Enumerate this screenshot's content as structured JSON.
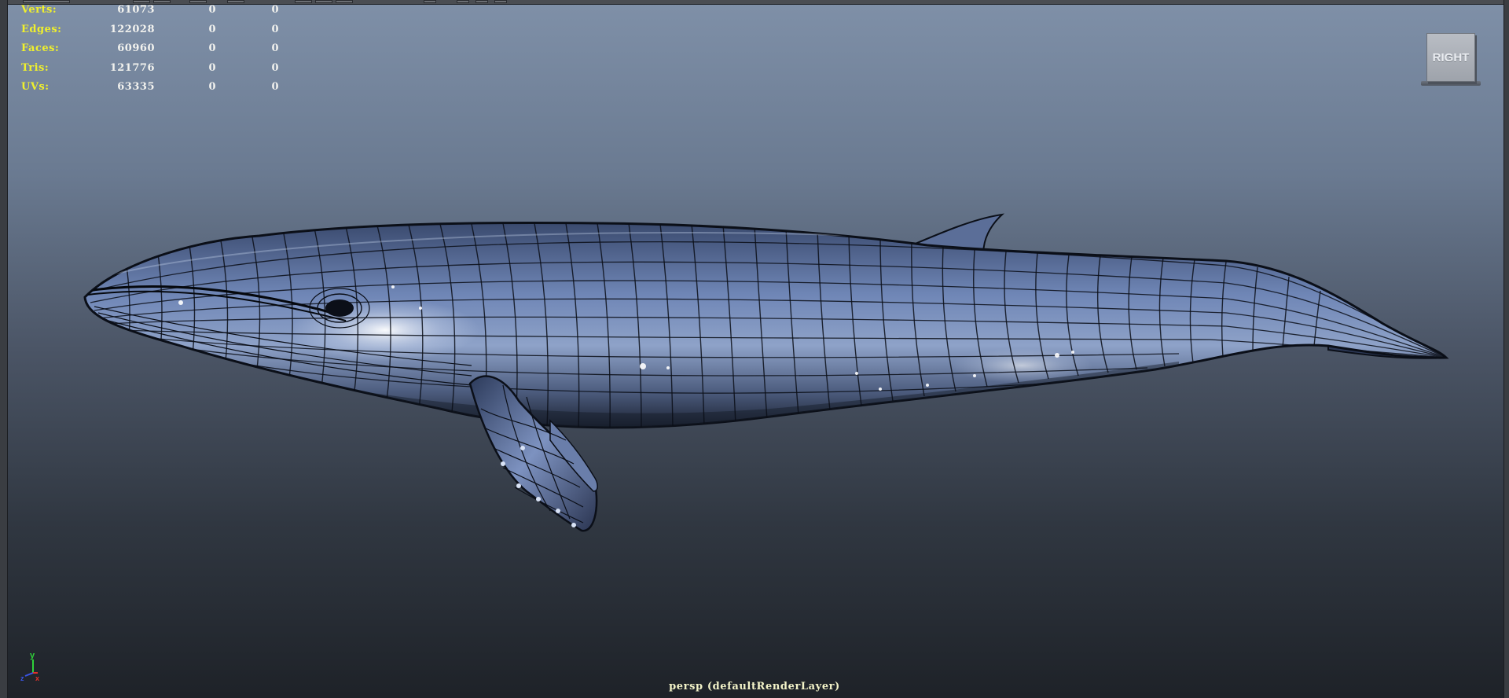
{
  "viewport": {
    "camera_label": "persp (defaultRenderLayer)",
    "view_cube_label": "RIGHT",
    "axis": {
      "y_label": "y",
      "z_label": "z",
      "x_label": "x"
    }
  },
  "hud": {
    "rows": [
      {
        "label": "Verts:",
        "v1": "61073",
        "v2": "0",
        "v3": "0"
      },
      {
        "label": "Edges:",
        "v1": "122028",
        "v2": "0",
        "v3": "0"
      },
      {
        "label": "Faces:",
        "v1": "60960",
        "v2": "0",
        "v3": "0"
      },
      {
        "label": "Tris:",
        "v1": "121776",
        "v2": "0",
        "v3": "0"
      },
      {
        "label": "UVs:",
        "v1": "63335",
        "v2": "0",
        "v3": "0"
      }
    ]
  },
  "colors": {
    "hud_label": "#f0f02c",
    "hud_value": "#f2f2ee",
    "axis_y": "#2fd13a",
    "axis_x": "#e0322a",
    "axis_z": "#3a55e6"
  }
}
